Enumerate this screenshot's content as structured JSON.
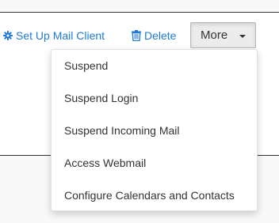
{
  "toolbar": {
    "setup_label": "Set Up Mail Client",
    "setup_icon": "gear-icon",
    "delete_label": "Delete",
    "delete_icon": "trash-icon",
    "more_label": "More",
    "link_color": "#1f7ad6"
  },
  "more_menu": {
    "items": [
      "Suspend",
      "Suspend Login",
      "Suspend Incoming Mail",
      "Access Webmail",
      "Configure Calendars and Contacts"
    ]
  }
}
